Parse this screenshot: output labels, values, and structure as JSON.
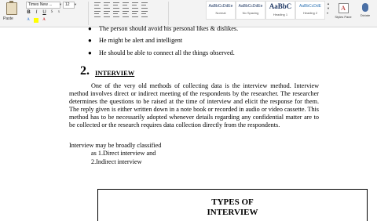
{
  "ribbon": {
    "paste_label": "Paste",
    "font_family": "Times New ...",
    "font_size": "12",
    "format_buttons": [
      "B",
      "I",
      "U"
    ],
    "styles": [
      {
        "sample": "AaBbCcDdEe",
        "name": "Normal",
        "kind": "small"
      },
      {
        "sample": "AaBbCcDdEe",
        "name": "No Spacing",
        "kind": "small"
      },
      {
        "sample": "AaBbC",
        "name": "Heading 1",
        "kind": "big"
      },
      {
        "sample": "AaBbCcDdE",
        "name": "Heading 2",
        "kind": "color"
      }
    ],
    "styles_pane_label": "Styles Pane",
    "dictate_label": "Dictate"
  },
  "document": {
    "bullets": [
      "The person should avoid his personal likes & dislikes.",
      "He might be alert and intelligent",
      "He should be able to connect all the things observed."
    ],
    "section_number": "2.",
    "section_title": "INTERVIEW",
    "paragraph": "One of the very old methods of collecting data is the interview method. Interview method involves direct or indirect meeting of the respondents by the researcher. The researcher determines the questions to be raised at the time of interview and elicit the response for them. The reply given is either written down in a note book or recorded in audio or video cassette. This method has to be necessarily adopted whenever details regarding any confidential matter are to be collected or the research requires data collection directly from the respondents.",
    "classified_line": "Interview may be broadly classified",
    "types": [
      "as 1.Direct interview and",
      "2.Indirect interview"
    ],
    "box_title_line1": "TYPES OF",
    "box_title_line2": "INTERVIEW"
  }
}
